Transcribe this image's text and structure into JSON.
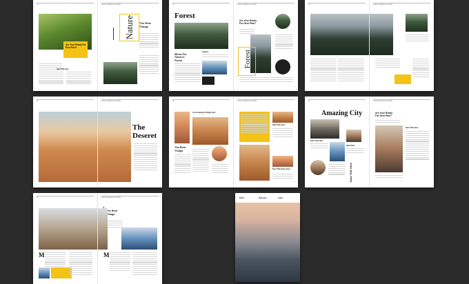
{
  "header_text": "Sample Magazine Template",
  "page_num": "01",
  "callout_text": "Are Your Ready For Next Plan?",
  "body_heading": "Hard Title Here",
  "side_heading": "The Real Things",
  "spread_nature": {
    "vertical_title": "Nature",
    "heading": "The Real Things"
  },
  "spread_forest": {
    "title": "Forest",
    "left_heading": "Where For Travel In Forest",
    "left_sub": "Caption",
    "right_heading": "Are Your Ready For Next Plan?",
    "vertical_title": "Forest"
  },
  "spread_desert": {
    "title_line1": "The",
    "title_line2": "Deseret"
  },
  "spread_dunes": {
    "left_heading": "The Real Things",
    "top_caption": "Your Heading In Right Here",
    "right_heading": "Hard Title Here",
    "right_heading2": "Best Title Enjoy Here"
  },
  "spread_city": {
    "title": "Amazing City",
    "cap1": "Hard Title Here",
    "cap2": "Hard Title",
    "vertical_caption": "Hard Title Here",
    "right_heading": "Are Your Ready For Next Plan?",
    "right_sub": "Hard Title Here"
  },
  "spread_camp": {
    "heading": "The Real Things",
    "dropcap": "M",
    "dropcap2": "M"
  },
  "cover": {
    "labels": [
      "Photo",
      "Title Here",
      "Label"
    ]
  }
}
